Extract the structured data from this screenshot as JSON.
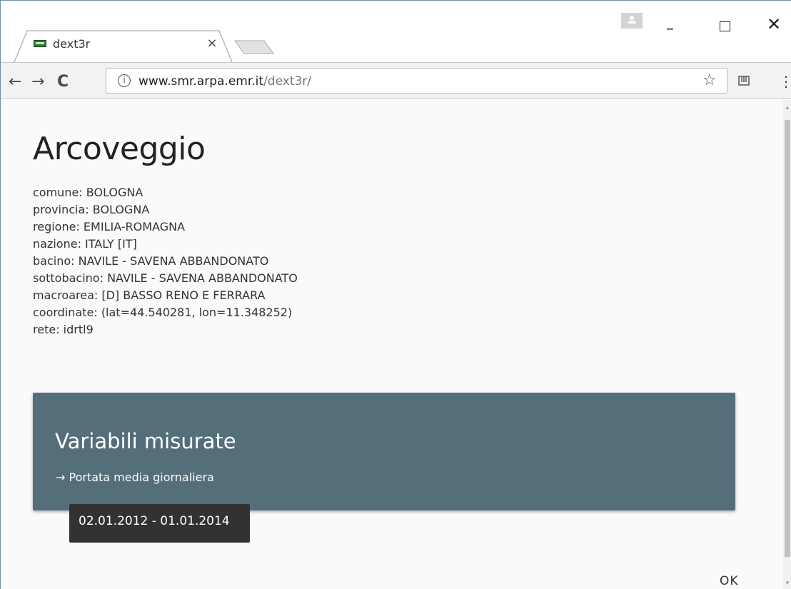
{
  "browser": {
    "tab_title": "dext3r",
    "tab_close": "×",
    "url_host": "www.smr.arpa.emr.it",
    "url_path": "/dext3r/",
    "info_glyph": "i",
    "back_glyph": "←",
    "forward_glyph": "→",
    "reload_glyph": "C",
    "star_glyph": "☆",
    "menu_glyph": "⋮",
    "minimize_glyph": "–",
    "close_glyph": "✕"
  },
  "station": {
    "title": "Arcoveggio",
    "details": [
      "comune: BOLOGNA",
      "provincia: BOLOGNA",
      "regione: EMILIA-ROMAGNA",
      "nazione: ITALY [IT]",
      "bacino: NAVILE - SAVENA ABBANDONATO",
      "sottobacino: NAVILE - SAVENA ABBANDONATO",
      "macroarea: [D] BASSO RENO E FERRARA",
      "coordinate: (lat=44.540281, lon=11.348252)",
      "rete: idrtl9"
    ]
  },
  "variables_card": {
    "title": "Variabili misurate",
    "link": "→ Portata media giornaliera"
  },
  "tooltip": {
    "text": "02.01.2012 - 01.01.2014"
  },
  "dialog": {
    "ok_label": "OK"
  },
  "colors": {
    "card_background": "#546e7a",
    "tooltip_background": "#323232"
  }
}
